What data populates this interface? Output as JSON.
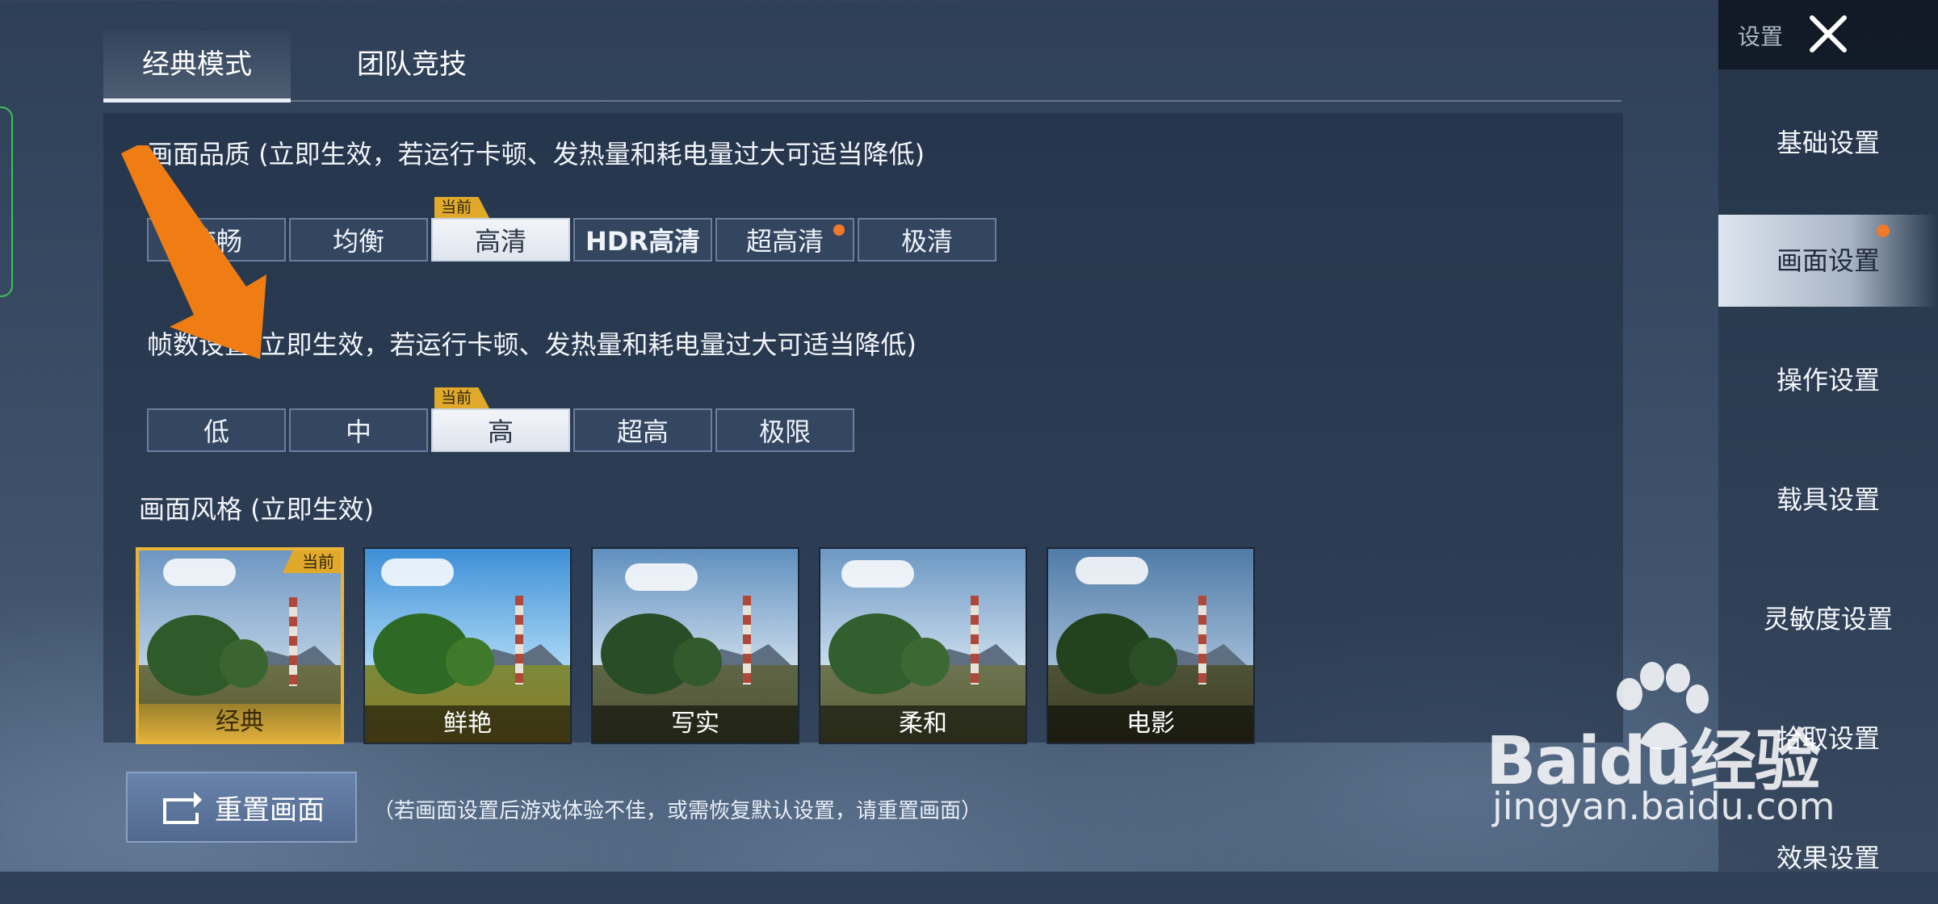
{
  "tabs": [
    {
      "label": "经典模式",
      "active": true
    },
    {
      "label": "团队竞技",
      "active": false
    }
  ],
  "quality": {
    "title": "画面品质 (立即生效，若运行卡顿、发热量和耗电量过大可适当降低)",
    "options": [
      "流畅",
      "均衡",
      "高清",
      "HDR高清",
      "超高清",
      "极清"
    ],
    "selected": "高清",
    "current_badge": "当前",
    "new_dot_on": "超高清"
  },
  "framerate": {
    "title": "帧数设置(立即生效，若运行卡顿、发热量和耗电量过大可适当降低)",
    "options": [
      "低",
      "中",
      "高",
      "超高",
      "极限"
    ],
    "selected": "高",
    "current_badge": "当前"
  },
  "style": {
    "title": "画面风格 (立即生效)",
    "options": [
      "经典",
      "鲜艳",
      "写实",
      "柔和",
      "电影"
    ],
    "selected": "经典",
    "current_badge": "当前"
  },
  "sidebar": {
    "title": "设置",
    "items": [
      "基础设置",
      "画面设置",
      "操作设置",
      "载具设置",
      "灵敏度设置",
      "拾取设置",
      "效果设置"
    ],
    "active": "画面设置"
  },
  "reset": {
    "label": "重置画面",
    "note": "（若画面设置后游戏体验不佳，或需恢复默认设置，请重置画面）"
  },
  "watermark": {
    "main": "Baidu经验",
    "sub": "jingyan.baidu.com"
  },
  "colors": {
    "accent_orange": "#f07a2a",
    "badge_gold": "#e0a92a",
    "arrow": "#f07d14"
  }
}
